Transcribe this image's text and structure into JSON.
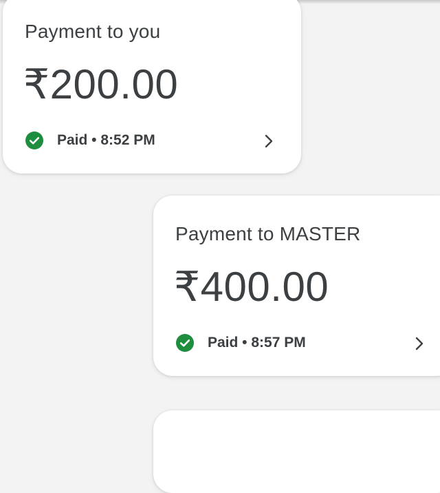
{
  "transactions": [
    {
      "title": "Payment to you",
      "amount": "₹200.00",
      "status": "Paid",
      "separator": "•",
      "time": "8:52 PM",
      "status_line": "Paid • 8:52 PM",
      "status_icon": "check-circle-icon",
      "action_icon": "chevron-right-icon"
    },
    {
      "title": "Payment to MASTER",
      "amount": "₹400.00",
      "status": "Paid",
      "separator": "•",
      "time": "8:57 PM",
      "status_line": "Paid • 8:57 PM",
      "status_icon": "check-circle-icon",
      "action_icon": "chevron-right-icon"
    }
  ],
  "colors": {
    "background": "#f3f3f3",
    "card": "#ffffff",
    "text": "#3c4043",
    "success": "#1e8e3e"
  }
}
